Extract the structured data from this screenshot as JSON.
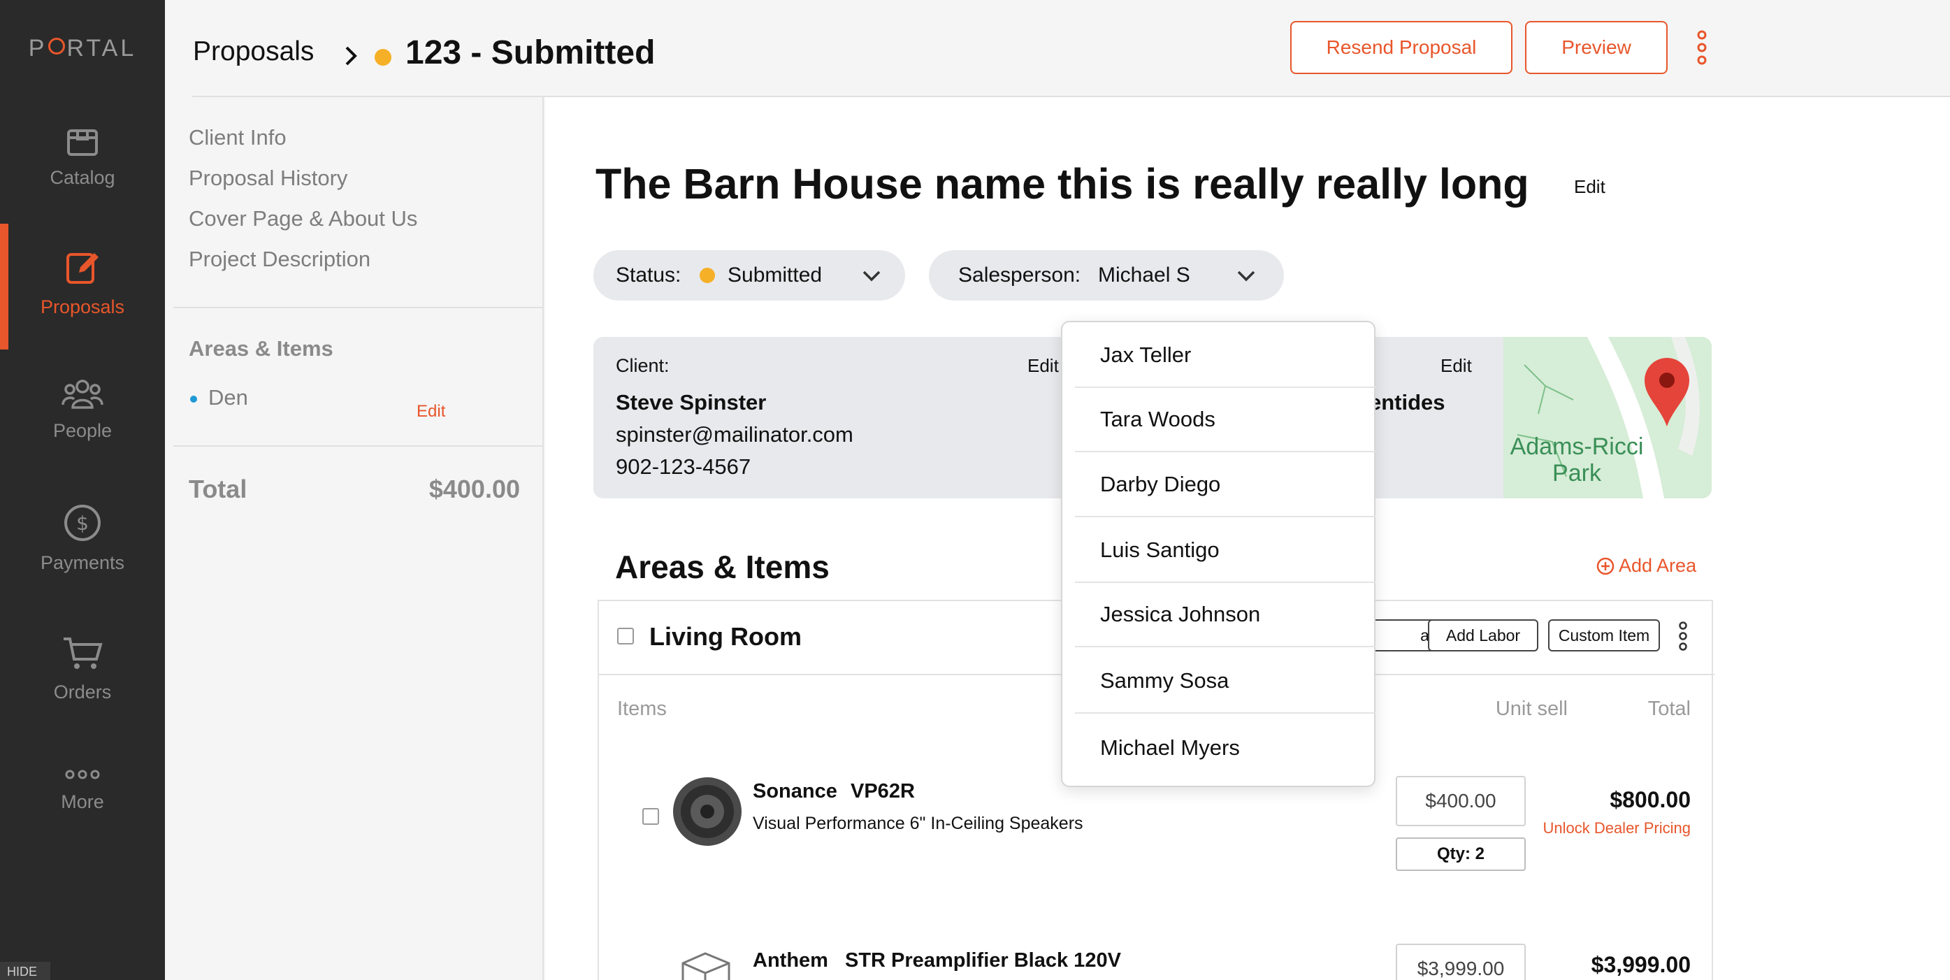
{
  "app": {
    "logo": "PORTAL"
  },
  "nav": {
    "items": [
      {
        "label": "Catalog",
        "icon": "box-icon"
      },
      {
        "label": "Proposals",
        "icon": "edit-doc-icon"
      },
      {
        "label": "People",
        "icon": "people-icon"
      },
      {
        "label": "Payments",
        "icon": "dollar-icon"
      },
      {
        "label": "Orders",
        "icon": "cart-icon"
      },
      {
        "label": "More",
        "icon": "dots-icon"
      }
    ],
    "hide_label": "HIDE"
  },
  "header": {
    "breadcrumb_root": "Proposals",
    "proposal_title": "123 - Submitted",
    "resend_label": "Resend Proposal",
    "preview_label": "Preview"
  },
  "subnav": {
    "links": [
      "Client Info",
      "Proposal History",
      "Cover Page & About Us",
      "Project Description"
    ],
    "areas_heading": "Areas & Items",
    "area_name": "Den",
    "edit_label": "Edit",
    "total_label": "Total",
    "total_value": "$400.00"
  },
  "main": {
    "project_title": "The Barn House name this is really really long",
    "edit_label": "Edit",
    "status_label": "Status:",
    "status_value": "Submitted",
    "salesperson_label": "Salesperson:",
    "salesperson_value": "Michael S",
    "client": {
      "label": "Client:",
      "edit": "Edit",
      "name": "Steve Spinster",
      "email": "spinster@mailinator.com",
      "phone": "902-123-4567",
      "second_edit": "Edit",
      "partial_name": "entides"
    },
    "map_label_1": "Adams-Ricci",
    "map_label_2": "Park",
    "areas_title": "Areas & Items",
    "add_area_label": "Add Area",
    "room": {
      "name": "Living Room",
      "btn_part": "art",
      "btn_add_labor": "Add Labor",
      "btn_custom_item": "Custom Item"
    },
    "table": {
      "col_items": "Items",
      "col_unit_sell": "Unit sell",
      "col_total": "Total"
    },
    "products": [
      {
        "brand": "Sonance",
        "model": "VP62R",
        "desc": "Visual Performance 6\" In-Ceiling Speakers",
        "unit_price": "$400.00",
        "qty": "Qty: 2",
        "total": "$800.00",
        "unlock": "Unlock Dealer Pricing"
      },
      {
        "brand": "Anthem",
        "model": "STR Preamplifier Black 120V",
        "unit_price": "$3,999.00",
        "total": "$3,999.00"
      }
    ]
  },
  "dropdown": {
    "options": [
      "Jax Teller",
      "Tara Woods",
      "Darby Diego",
      "Luis Santigo",
      "Jessica Johnson",
      "Sammy Sosa",
      "Michael Myers"
    ]
  },
  "colors": {
    "accent": "#e8562b",
    "status_dot": "#f5b027",
    "nav_bg": "#2a2a2a"
  }
}
